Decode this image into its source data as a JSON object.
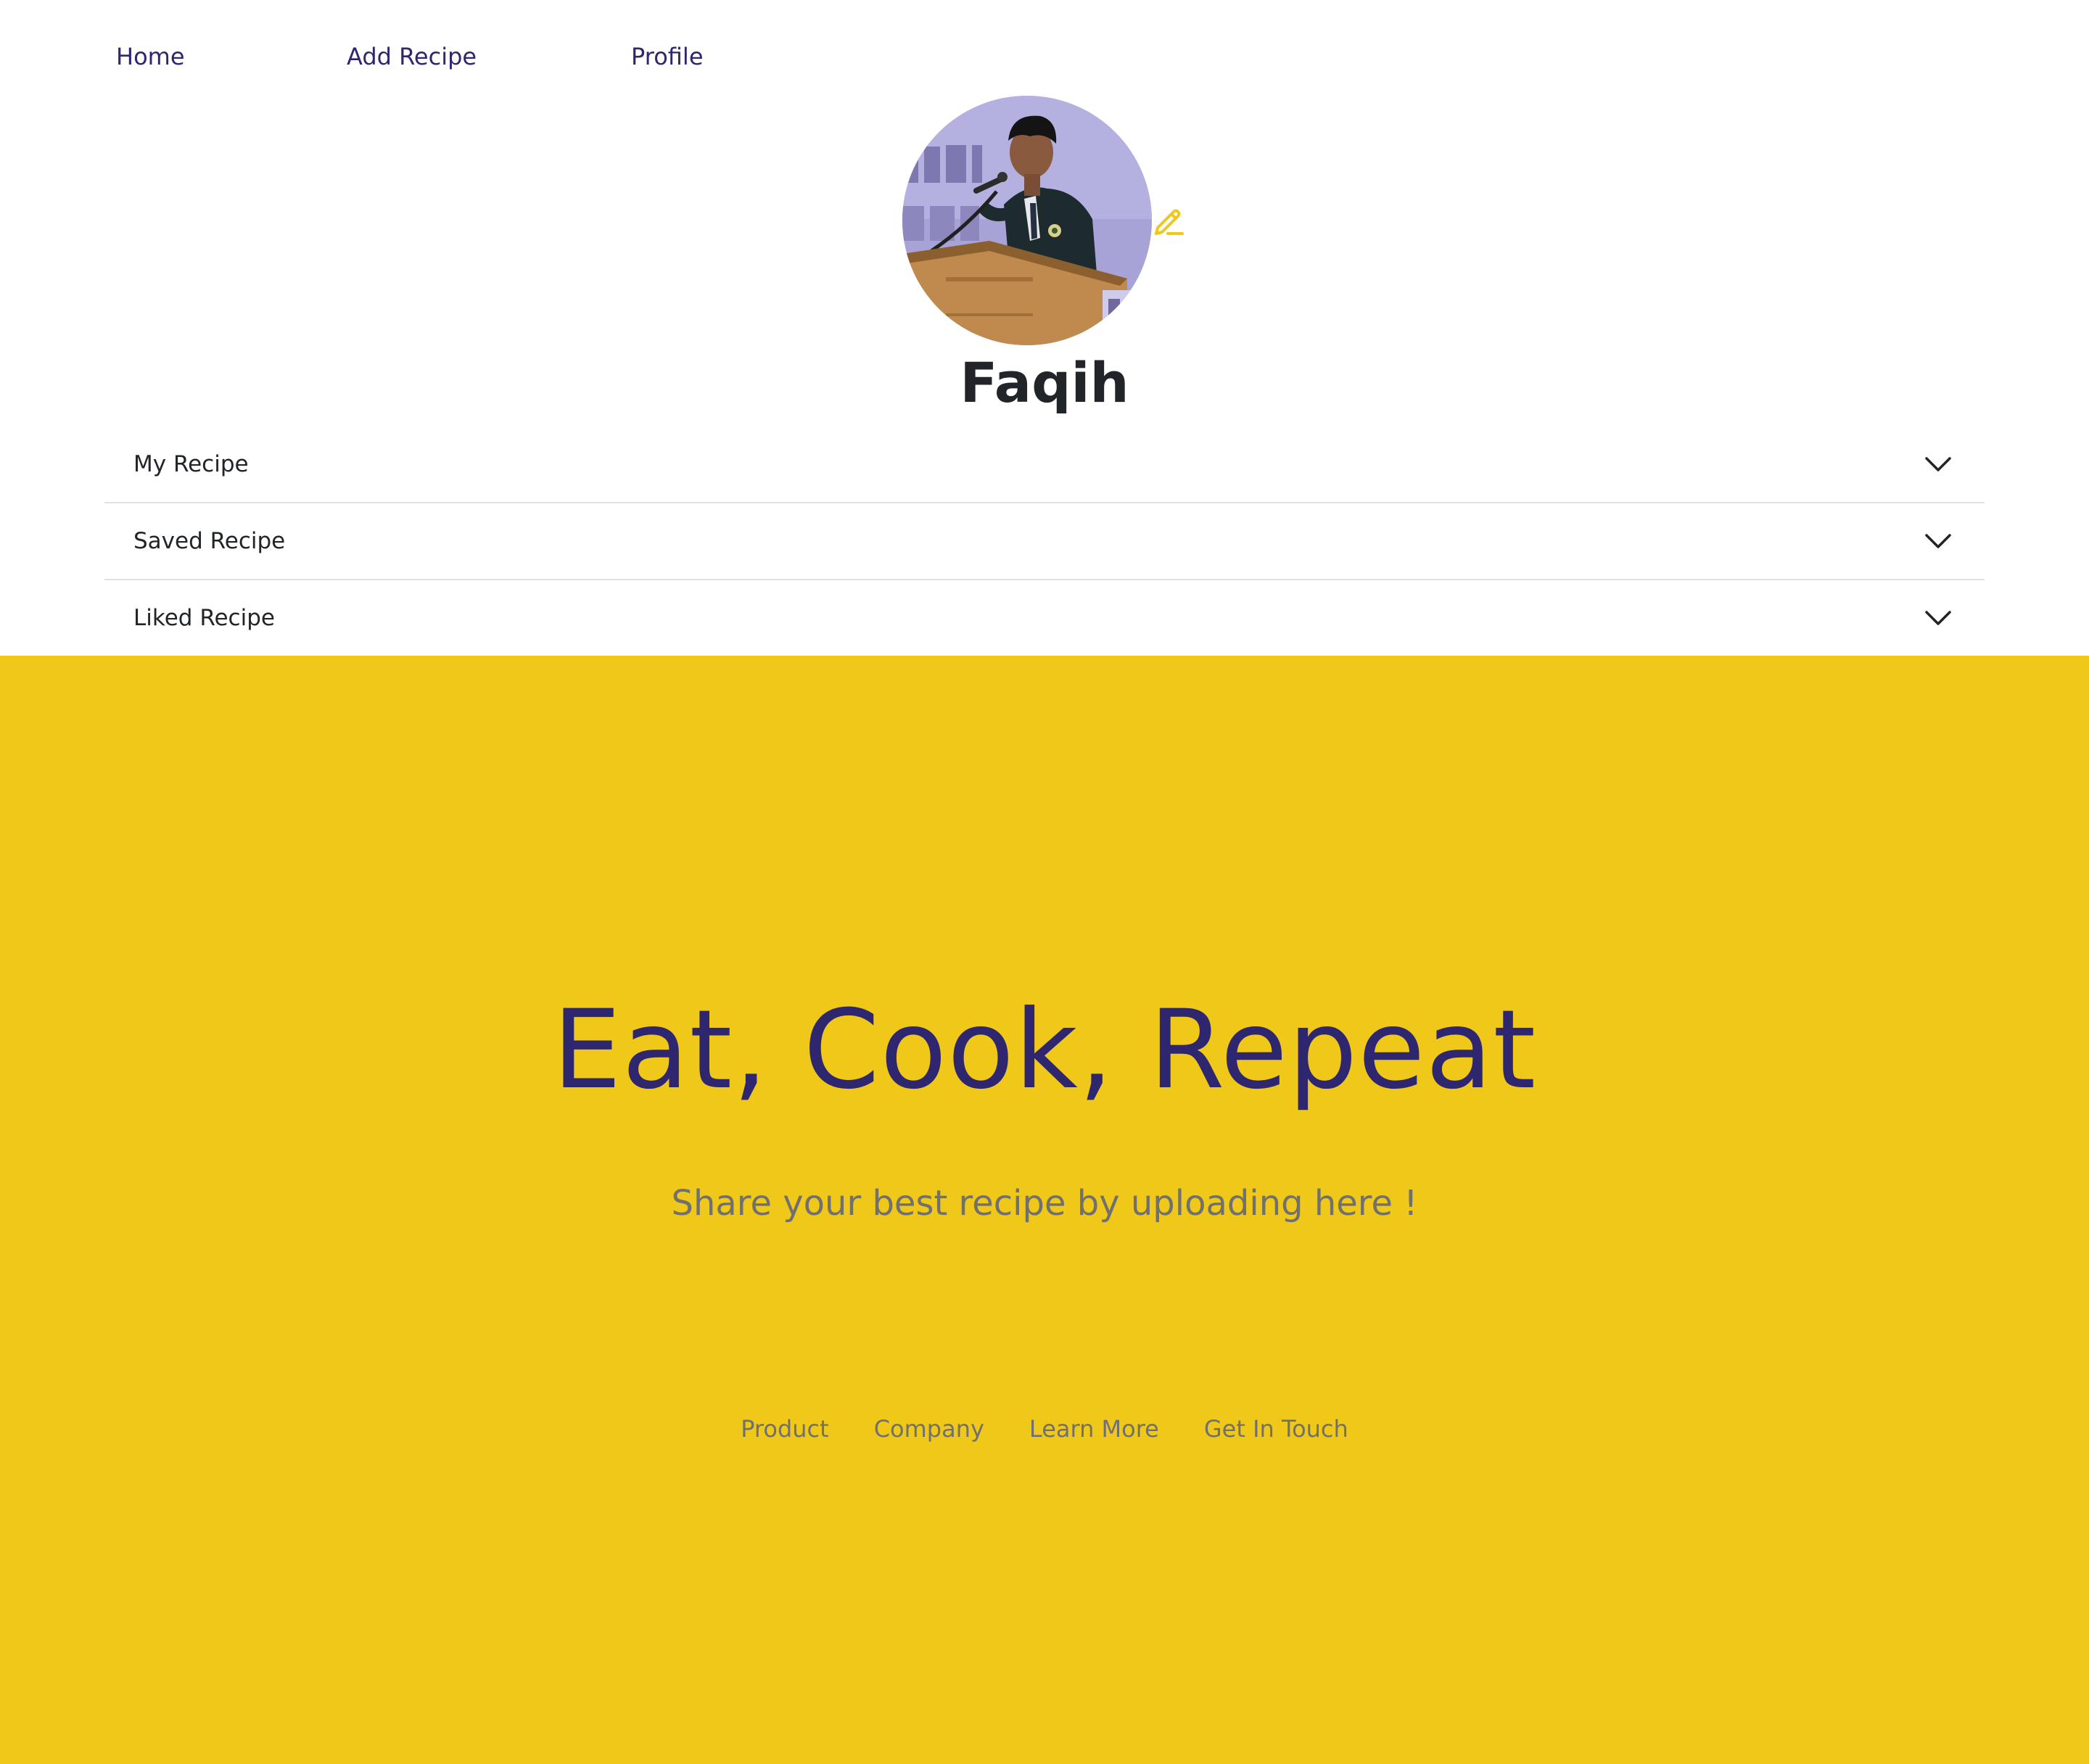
{
  "nav": {
    "home": "Home",
    "add_recipe": "Add Recipe",
    "profile": "Profile"
  },
  "profile": {
    "name": "Faqih",
    "avatar_icon": "profile-photo",
    "edit_icon": "pencil-icon"
  },
  "sections": [
    {
      "label": "My Recipe",
      "icon": "chevron-down-icon"
    },
    {
      "label": "Saved Recipe",
      "icon": "chevron-down-icon"
    },
    {
      "label": "Liked Recipe",
      "icon": "chevron-down-icon"
    }
  ],
  "hero": {
    "title": "Eat, Cook, Repeat",
    "subtitle": "Share your best recipe by uploading here !"
  },
  "footer": {
    "links": [
      "Product",
      "Company",
      "Learn More",
      "Get In Touch"
    ]
  },
  "colors": {
    "accent_yellow": "#efc81a",
    "primary_navy": "#2e266f",
    "text_dark": "#212529",
    "text_muted": "#707070",
    "divider": "#dee2e6"
  }
}
